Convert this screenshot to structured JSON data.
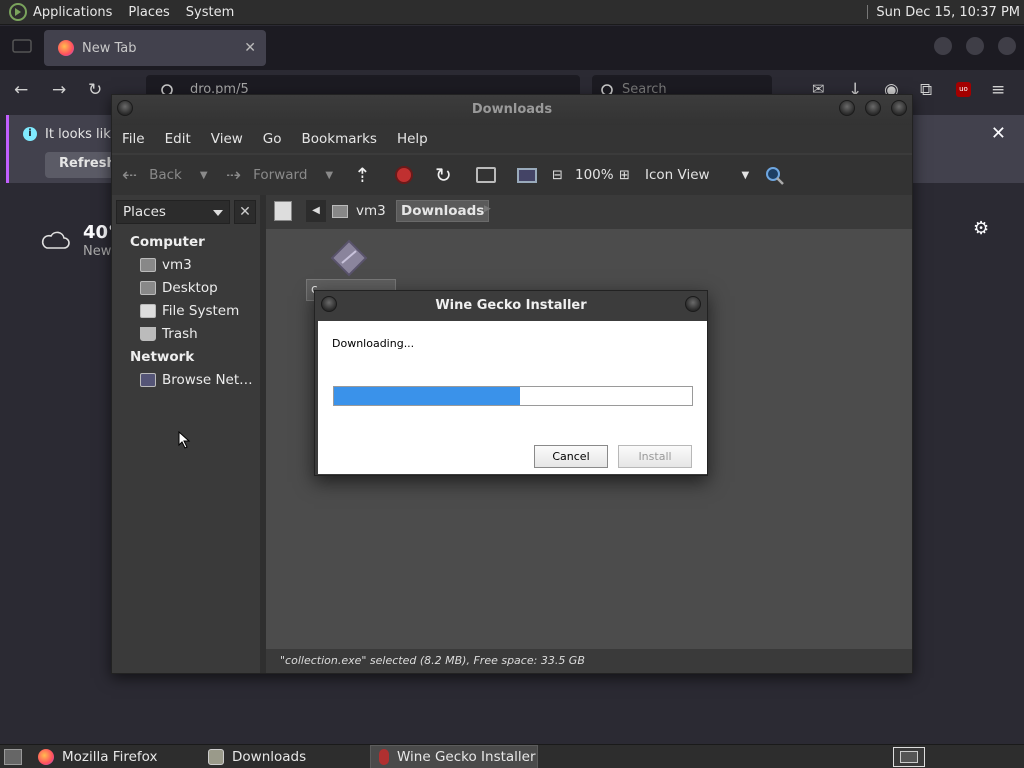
{
  "top_panel": {
    "menus": [
      "Applications",
      "Places",
      "System"
    ],
    "clock": "Sun Dec 15, 10:37 PM"
  },
  "firefox": {
    "tab_title": "New Tab",
    "url_text": "dro.pm/5",
    "search_placeholder": "Search",
    "notification_text": "It looks like",
    "notification_button": "Refresh F",
    "weather_temp": "40°",
    "weather_location": "New"
  },
  "caja": {
    "title": "Downloads",
    "menu": [
      "File",
      "Edit",
      "View",
      "Go",
      "Bookmarks",
      "Help"
    ],
    "toolbar": {
      "back": "Back",
      "forward": "Forward",
      "zoom": "100%",
      "view_mode": "Icon View"
    },
    "sidebar": {
      "header": "Places",
      "sections": [
        {
          "title": "Computer",
          "items": [
            "vm3",
            "Desktop",
            "File System",
            "Trash"
          ]
        },
        {
          "title": "Network",
          "items": [
            "Browse Net…"
          ]
        }
      ]
    },
    "path": [
      "vm3",
      "Downloads"
    ],
    "file_label": "c",
    "status": "\"collection.exe\" selected (8.2 MB), Free space: 33.5 GB"
  },
  "gecko": {
    "title": "Wine Gecko Installer",
    "message": "Downloading...",
    "progress": 0.52,
    "cancel": "Cancel",
    "install": "Install"
  },
  "taskbar": {
    "items": [
      "Mozilla Firefox",
      "Downloads",
      "Wine Gecko Installer"
    ],
    "active_index": 2
  },
  "colors": {
    "progress_fill": "#3a92ea",
    "notification_accent": "#c25fff"
  }
}
